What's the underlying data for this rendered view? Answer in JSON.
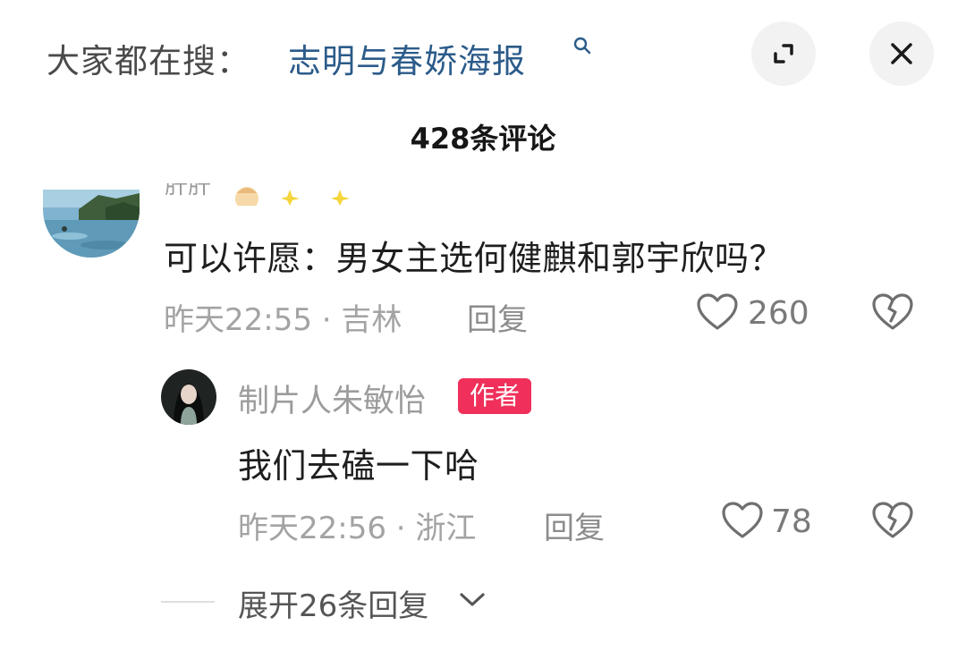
{
  "header": {
    "search_prefix": "大家都在搜：",
    "search_term": "志明与春娇海报",
    "search_icon": "search-icon",
    "expand_icon": "expand-icon",
    "close_icon": "close-icon"
  },
  "comments_header": {
    "count_label": "428条评论"
  },
  "comments": [
    {
      "username": "肝肝",
      "emoji_icons": [
        "person-emoji",
        "sparkle-emoji",
        "sparkle-emoji"
      ],
      "text": "可以许愿：男女主选何健麒和郭宇欣吗？",
      "meta": "昨天22:55 · 吉林",
      "reply_label": "回复",
      "likes": "260",
      "avatar": "landscape-avatar"
    }
  ],
  "reply": {
    "username": "制片人朱敏怡",
    "badge": "作者",
    "text": "我们去磕一下哈",
    "meta": "昨天22:56 · 浙江",
    "reply_label": "回复",
    "likes": "78",
    "avatar": "portrait-avatar"
  },
  "expand_replies": {
    "label": "展开26条回复"
  },
  "colors": {
    "search_term": "#2b5b8a",
    "author_badge": "#f0305a",
    "muted_text": "#a3a3a3"
  }
}
